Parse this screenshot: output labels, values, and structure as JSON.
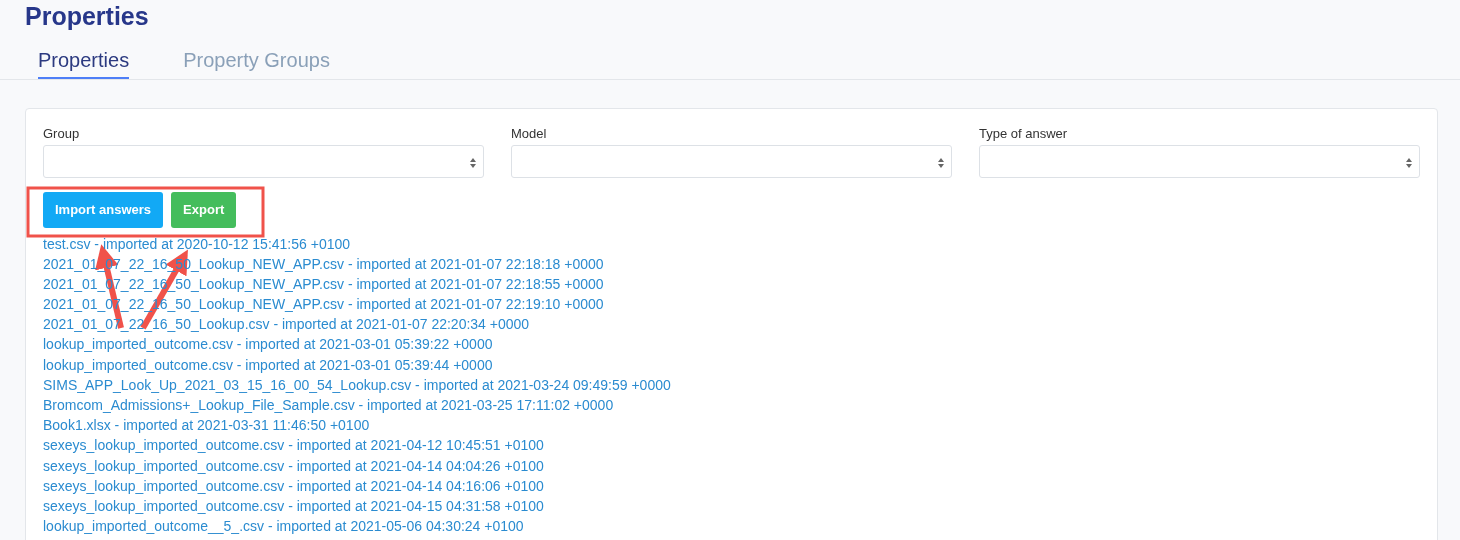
{
  "page_title": "Properties",
  "tabs": [
    {
      "label": "Properties",
      "selected": true
    },
    {
      "label": "Property Groups",
      "selected": false
    }
  ],
  "filters": [
    {
      "label": "Group"
    },
    {
      "label": "Model"
    },
    {
      "label": "Type of answer"
    }
  ],
  "buttons": [
    {
      "label": "Import answers",
      "kind": "primary"
    },
    {
      "label": "Export",
      "kind": "success"
    }
  ],
  "imports": [
    {
      "text": "test.csv - imported at 2020-10-12 15:41:56 +0100"
    },
    {
      "text": "2021_01_07_22_16_50_Lookup_NEW_APP.csv - imported at 2021-01-07 22:18:18 +0000"
    },
    {
      "text": "2021_01_07_22_16_50_Lookup_NEW_APP.csv - imported at 2021-01-07 22:18:55 +0000"
    },
    {
      "text": "2021_01_07_22_16_50_Lookup_NEW_APP.csv - imported at 2021-01-07 22:19:10 +0000"
    },
    {
      "text": "2021_01_07_22_16_50_Lookup.csv - imported at 2021-01-07 22:20:34 +0000"
    },
    {
      "text": "lookup_imported_outcome.csv - imported at 2021-03-01 05:39:22 +0000"
    },
    {
      "text": "lookup_imported_outcome.csv - imported at 2021-03-01 05:39:44 +0000"
    },
    {
      "text": "SIMS_APP_Look_Up_2021_03_15_16_00_54_Lookup.csv - imported at 2021-03-24 09:49:59 +0000"
    },
    {
      "text": "Bromcom_Admissions+_Lookup_File_Sample.csv - imported at 2021-03-25 17:11:02 +0000"
    },
    {
      "text": "Book1.xlsx - imported at 2021-03-31 11:46:50 +0100"
    },
    {
      "text": "sexeys_lookup_imported_outcome.csv - imported at 2021-04-12 10:45:51 +0100"
    },
    {
      "text": "sexeys_lookup_imported_outcome.csv - imported at 2021-04-14 04:04:26 +0100"
    },
    {
      "text": "sexeys_lookup_imported_outcome.csv - imported at 2021-04-14 04:16:06 +0100"
    },
    {
      "text": "sexeys_lookup_imported_outcome.csv - imported at 2021-04-15 04:31:58 +0100"
    },
    {
      "text": "lookup_imported_outcome__5_.csv - imported at 2021-05-06 04:30:24 +0100"
    }
  ]
}
